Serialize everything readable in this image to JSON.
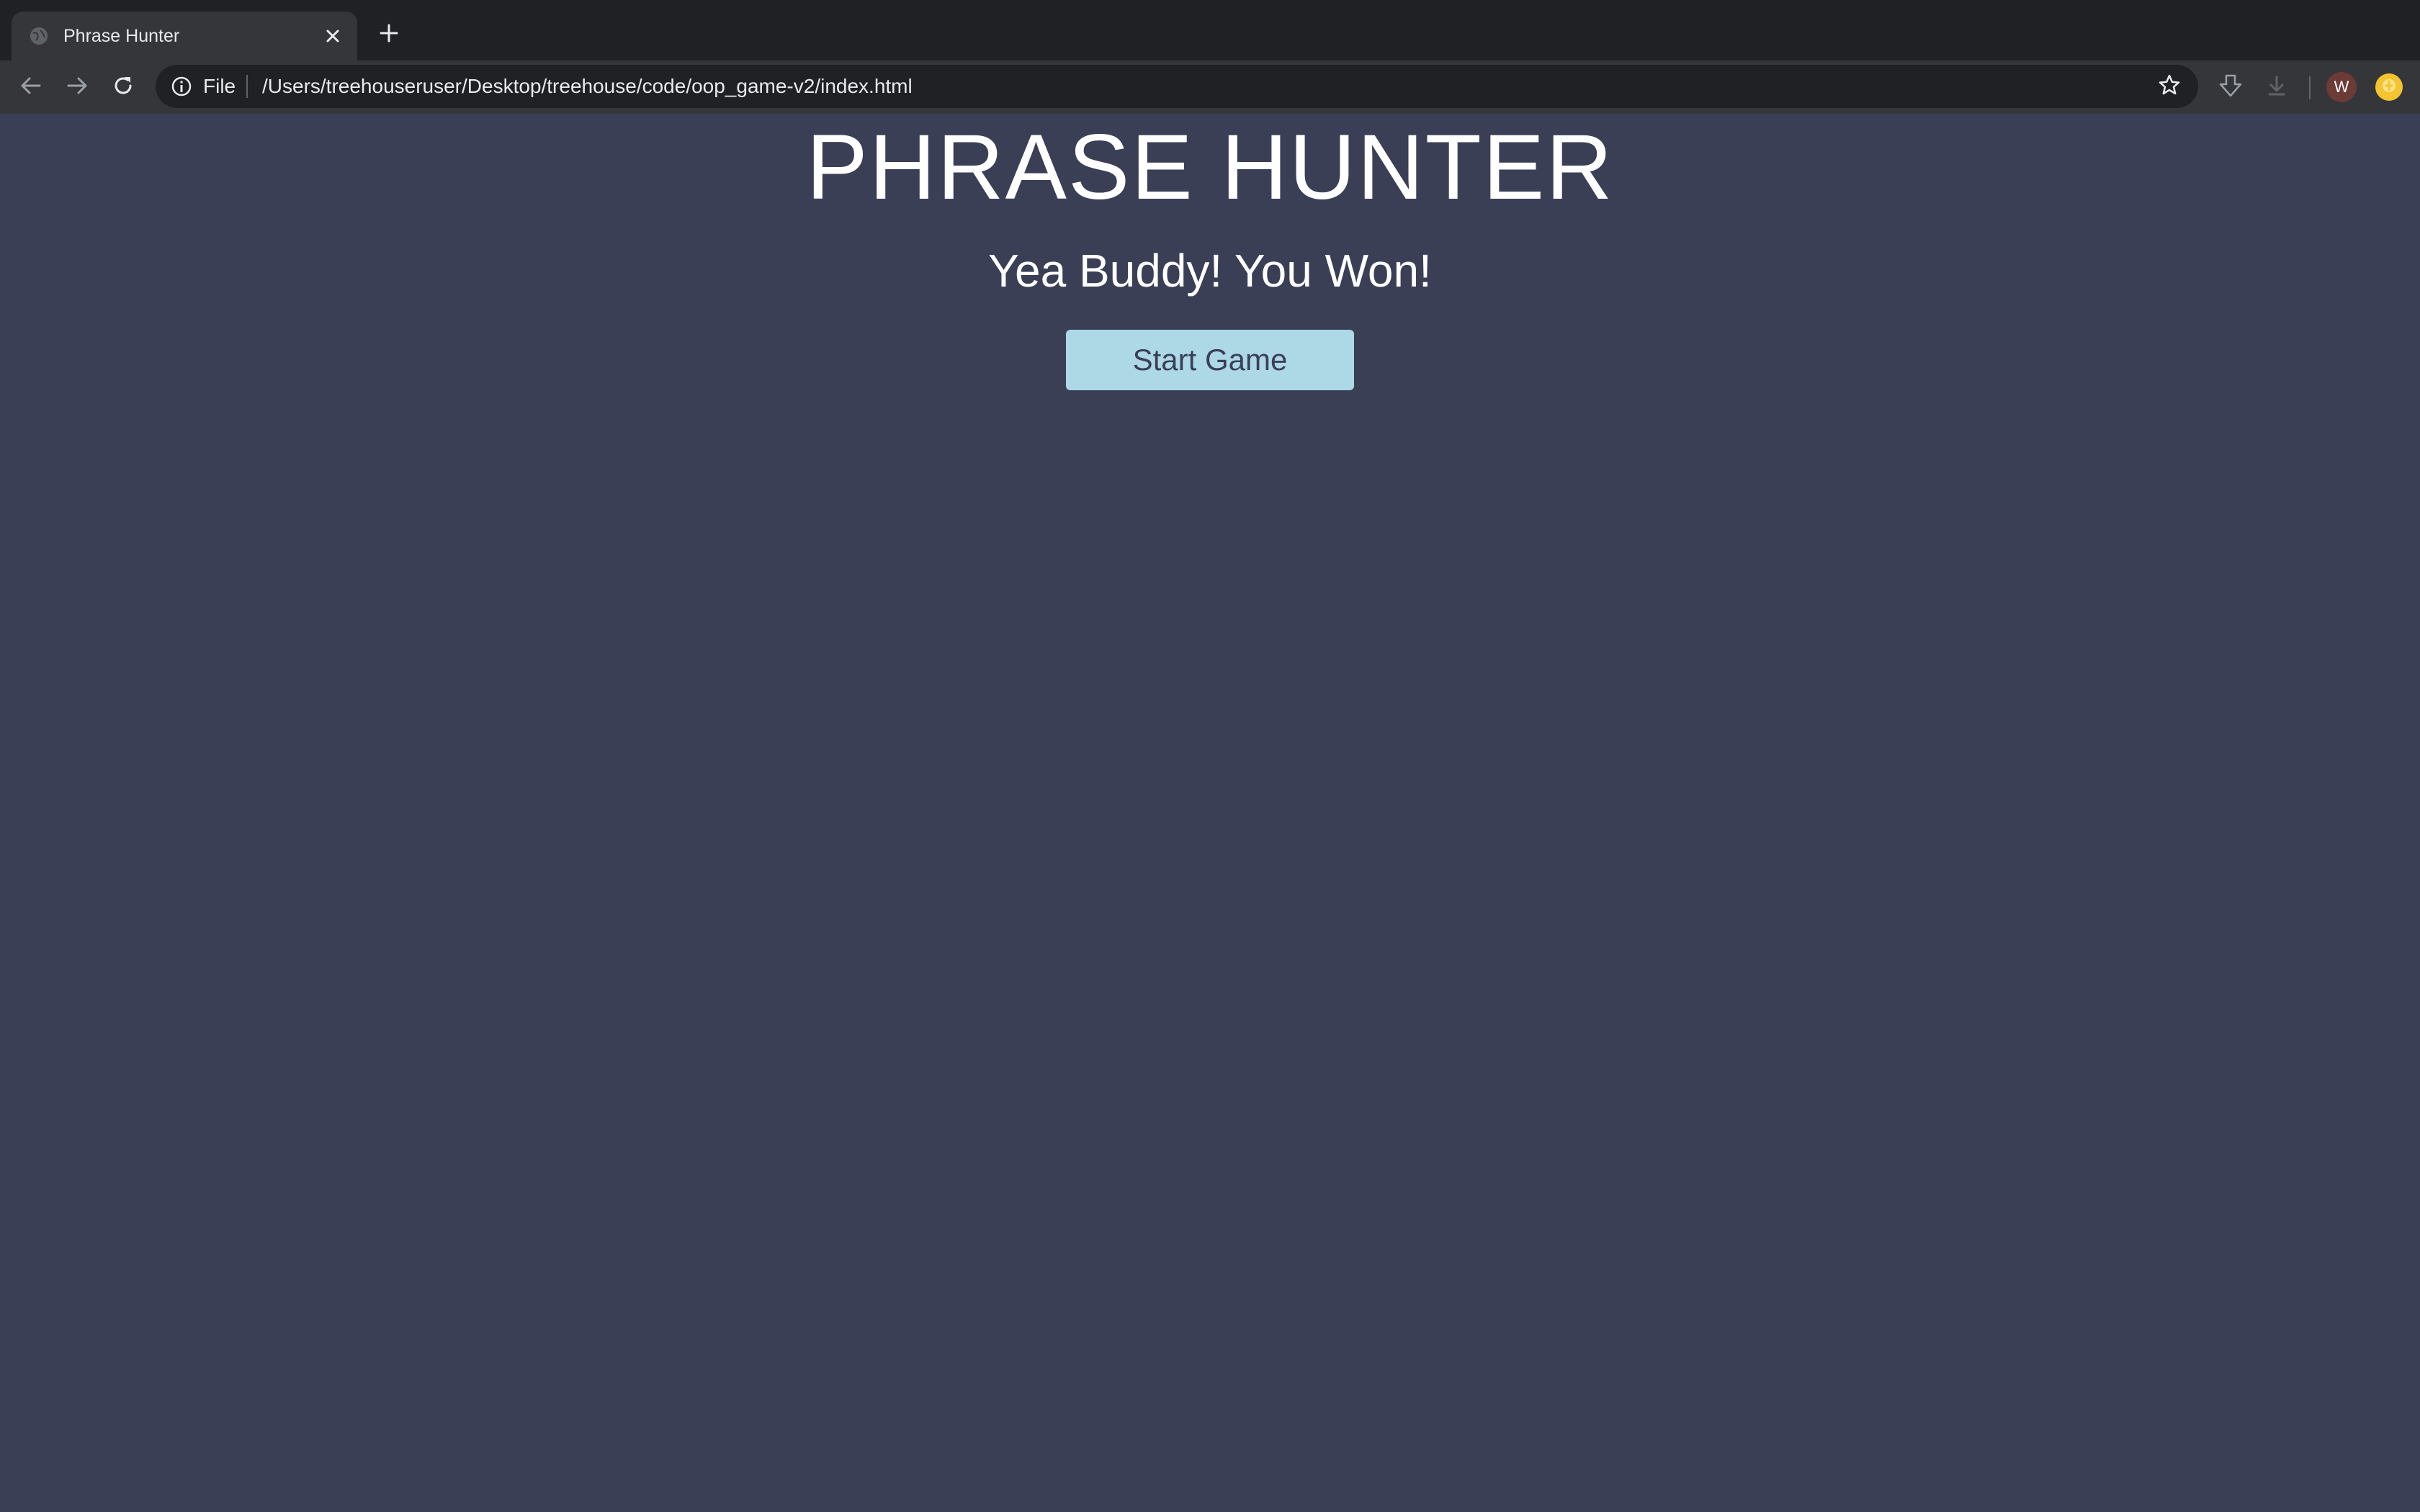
{
  "browser": {
    "tab": {
      "title": "Phrase Hunter"
    },
    "address_bar": {
      "scheme_label": "File",
      "url": "/Users/treehouseruser/Desktop/treehouse/code/oop_game-v2/index.html"
    },
    "profile": {
      "initial": "W"
    }
  },
  "page": {
    "title": "PHRASE HUNTER",
    "message": "Yea Buddy! You Won!",
    "start_button_label": "Start Game"
  },
  "colors": {
    "page_background": "#3b3f56",
    "button_background": "#add8e6",
    "button_text": "#3b3f56",
    "heading_text": "#ffffff",
    "browser_frame": "#202124",
    "browser_toolbar": "#35363a"
  },
  "icons": {
    "tab_favicon": "globe-icon",
    "tab_close": "close-icon",
    "new_tab": "plus-icon",
    "back": "arrow-left-icon",
    "forward": "arrow-right-icon",
    "reload": "reload-icon",
    "site_info": "info-icon",
    "bookmark": "star-icon",
    "extension_1": "download-arrow-icon",
    "extension_2": "download-icon",
    "extension_3": "coin-icon"
  }
}
